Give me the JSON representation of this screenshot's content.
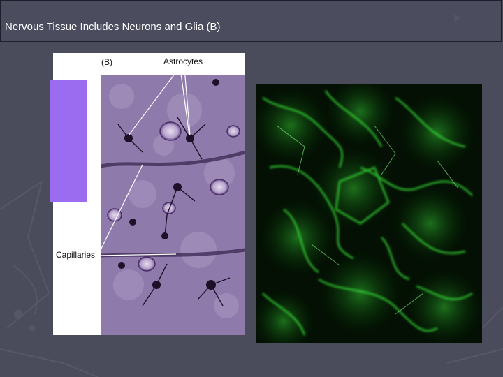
{
  "slide": {
    "title": "Nervous Tissue Includes Neurons and Glia (B)"
  },
  "figure_b": {
    "panel_label": "(B)",
    "astrocytes_label": "Astrocytes",
    "capillaries_label": "Capillaries"
  },
  "colors": {
    "background": "#4a4c5c",
    "accent_block": "#9b6bf0",
    "stain_purple": "#8c78a8",
    "fluorescence_green": "#2fd12f"
  }
}
